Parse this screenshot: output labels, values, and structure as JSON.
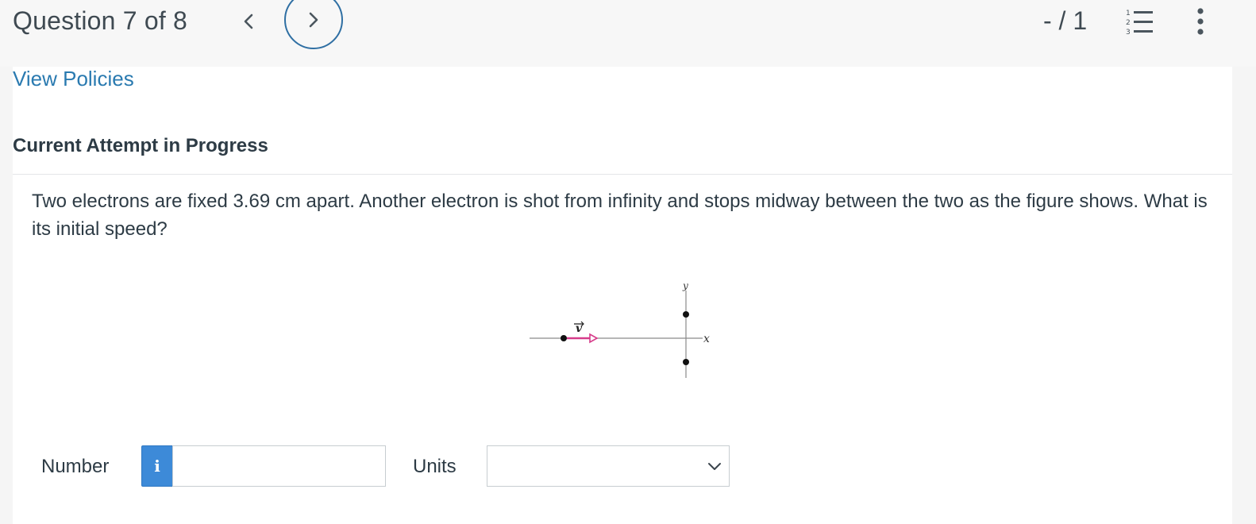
{
  "header": {
    "question_counter": "Question 7 of 8",
    "score": "- / 1",
    "prev_icon": "chevron-left-icon",
    "next_icon": "chevron-right-icon",
    "list_icon": "numbered-list-icon",
    "more_icon": "vertical-ellipsis-icon",
    "accent_color": "#2f6fa3"
  },
  "main": {
    "policies_link": "View Policies",
    "attempt_title": "Current Attempt in Progress",
    "question_text": "Two electrons are fixed 3.69 cm apart. Another electron is shot from infinity and stops midway between the two as the figure shows. What is its initial speed?",
    "figure": {
      "axis_x_label": "x",
      "axis_y_label": "y",
      "velocity_label": "v",
      "velocity_color": "#d63c8a"
    }
  },
  "answer": {
    "number_label": "Number",
    "info_button": "i",
    "number_value": "",
    "units_label": "Units",
    "units_selected": ""
  }
}
